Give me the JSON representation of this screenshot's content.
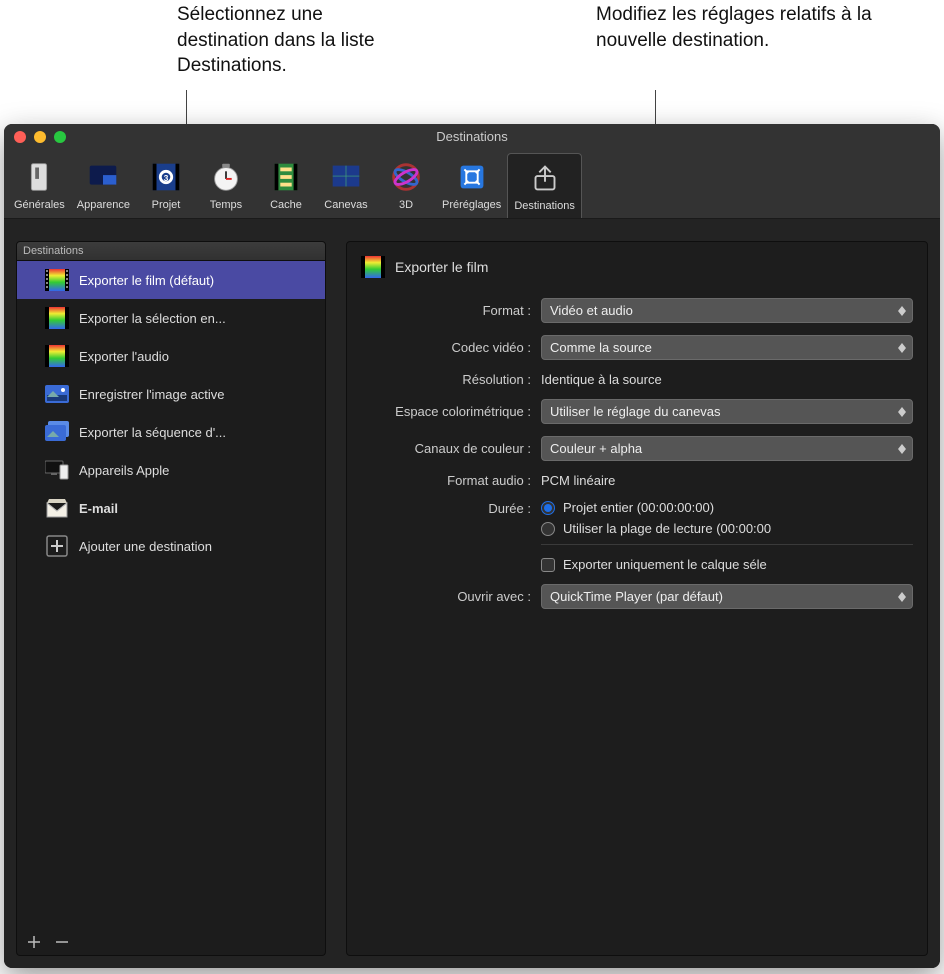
{
  "callouts": {
    "left": "Sélectionnez une destination dans la liste Destinations.",
    "right": "Modifiez les réglages relatifs à la nouvelle destination."
  },
  "window": {
    "title": "Destinations"
  },
  "toolbar": {
    "items": [
      {
        "label": "Générales"
      },
      {
        "label": "Apparence"
      },
      {
        "label": "Projet"
      },
      {
        "label": "Temps"
      },
      {
        "label": "Cache"
      },
      {
        "label": "Canevas"
      },
      {
        "label": "3D"
      },
      {
        "label": "Préréglages"
      },
      {
        "label": "Destinations"
      }
    ]
  },
  "sidebar": {
    "header": "Destinations",
    "items": [
      {
        "label": "Exporter le film (défaut)"
      },
      {
        "label": "Exporter la sélection en..."
      },
      {
        "label": "Exporter l'audio"
      },
      {
        "label": "Enregistrer l'image active"
      },
      {
        "label": "Exporter la séquence d'..."
      },
      {
        "label": "Appareils Apple"
      },
      {
        "label": "E-mail"
      },
      {
        "label": "Ajouter une destination"
      }
    ]
  },
  "detail": {
    "title": "Exporter le film",
    "labels": {
      "format": "Format :",
      "codec": "Codec vidéo :",
      "resolution": "Résolution :",
      "colorspace": "Espace colorimétrique :",
      "channels": "Canaux de couleur :",
      "audioformat": "Format audio :",
      "duration": "Durée :",
      "openwith": "Ouvrir avec :"
    },
    "values": {
      "format": "Vidéo et audio",
      "codec": "Comme la source",
      "resolution": "Identique à la source",
      "colorspace": "Utiliser le réglage du canevas",
      "channels": "Couleur + alpha",
      "audioformat": "PCM linéaire",
      "duration_opt1": "Projet entier (00:00:00:00)",
      "duration_opt2": "Utiliser la plage de lecture (00:00:00",
      "export_only": "Exporter uniquement le calque séle",
      "openwith": "QuickTime Player (par défaut)"
    }
  }
}
